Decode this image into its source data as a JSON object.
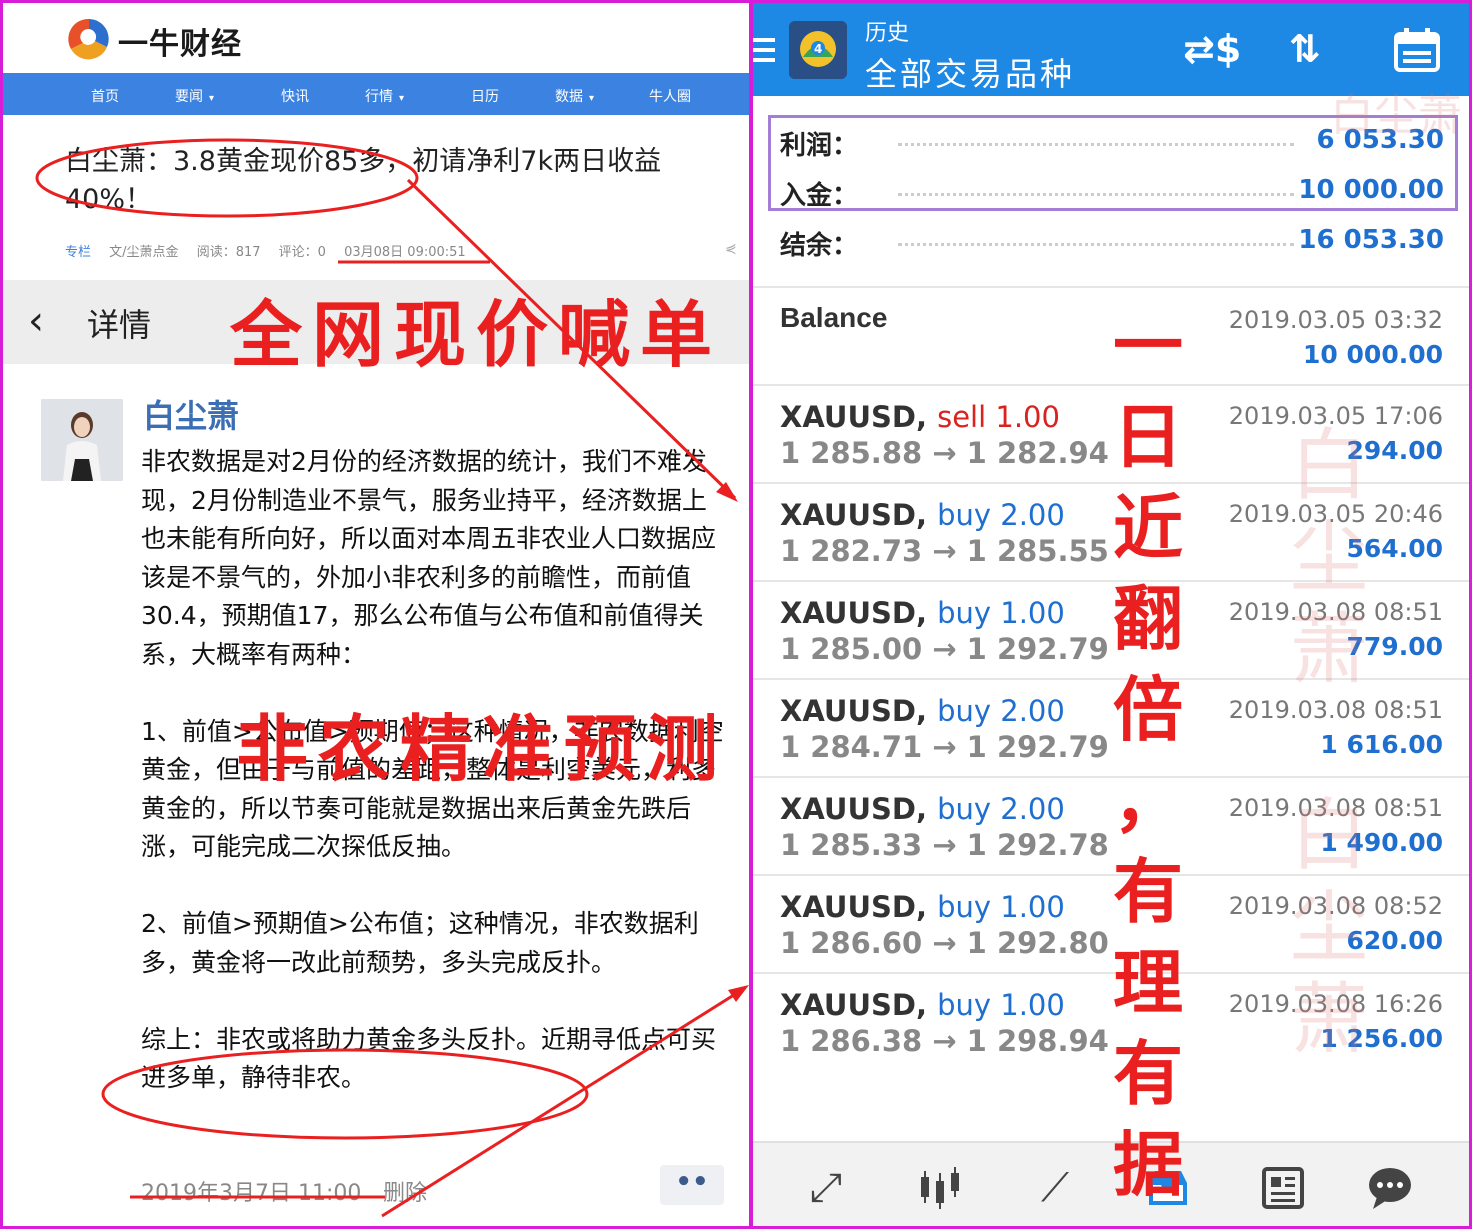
{
  "left": {
    "logo_text": "一牛财经",
    "nav": [
      {
        "label": "首页",
        "dropdown": false
      },
      {
        "label": "要闻",
        "dropdown": true
      },
      {
        "label": "快讯",
        "dropdown": false
      },
      {
        "label": "行情",
        "dropdown": true
      },
      {
        "label": "日历",
        "dropdown": false
      },
      {
        "label": "数据",
        "dropdown": true
      },
      {
        "label": "牛人圈",
        "dropdown": false
      }
    ],
    "article_title": "白尘萧：3.8黄金现价85多，初请净利7k两日收益40%！",
    "meta": {
      "column": "专栏",
      "author": "文/尘萧点金",
      "reads": "阅读：817",
      "comments": "评论：0",
      "date": "03月08日 09:00:51"
    },
    "detail_label": "详情",
    "author_name": "白尘萧",
    "paragraphs": [
      "非农数据是对2月份的经济数据的统计，我们不难发现，2月份制造业不景气，服务业持平，经济数据上也未能有所向好，所以面对本周五非农业人口数据应该是不景气的，外加小非农利多的前瞻性，而前值30.4，预期值17，那么公布值与公布值和前值得关系，大概率有两种：",
      "1、前值>公布值>预期值；这种情况，非农数据利空黄金，但由于与前值的差距，整体是利空美元，利多黄金的，所以节奏可能就是数据出来后黄金先跌后涨，可能完成二次探低反抽。",
      "2、前值>预期值>公布值；这种情况，非农数据利多，黄金将一改此前颓势，多头完成反扑。",
      "综上：非农或将助力黄金多头反扑。近期寻低点可买进多单，静待非农。"
    ],
    "post_time": "2019年3月7日 11:00",
    "delete_label": "删除",
    "more_label": "••"
  },
  "right": {
    "header_sub": "历史",
    "header_title": "全部交易品种",
    "summary": [
      {
        "label": "利润：",
        "value": "6 053.30"
      },
      {
        "label": "入金：",
        "value": "10 000.00"
      },
      {
        "label": "结余：",
        "value": "16 053.30"
      }
    ],
    "balance": {
      "title": "Balance",
      "date": "2019.03.05 03:32",
      "amount": "10 000.00"
    },
    "trades": [
      {
        "symbol": "XAUUSD,",
        "side": "sell",
        "volume": "sell 1.00",
        "prices": "1 285.88 → 1 282.94",
        "date": "2019.03.05 17:06",
        "amount": "294.00"
      },
      {
        "symbol": "XAUUSD,",
        "side": "buy",
        "volume": "buy 2.00",
        "prices": "1 282.73 → 1 285.55",
        "date": "2019.03.05 20:46",
        "amount": "564.00"
      },
      {
        "symbol": "XAUUSD,",
        "side": "buy",
        "volume": "buy 1.00",
        "prices": "1 285.00 → 1 292.79",
        "date": "2019.03.08 08:51",
        "amount": "779.00"
      },
      {
        "symbol": "XAUUSD,",
        "side": "buy",
        "volume": "buy 2.00",
        "prices": "1 284.71 → 1 292.79",
        "date": "2019.03.08 08:51",
        "amount": "1 616.00"
      },
      {
        "symbol": "XAUUSD,",
        "side": "buy",
        "volume": "buy 2.00",
        "prices": "1 285.33 → 1 292.78",
        "date": "2019.03.08 08:51",
        "amount": "1 490.00"
      },
      {
        "symbol": "XAUUSD,",
        "side": "buy",
        "volume": "buy 1.00",
        "prices": "1 286.60 → 1 292.80",
        "date": "2019.03.08 08:52",
        "amount": "620.00"
      },
      {
        "symbol": "XAUUSD,",
        "side": "buy",
        "volume": "buy 1.00",
        "prices": "1 286.38 → 1 298.94",
        "date": "2019.03.08 16:26",
        "amount": "1 256.00"
      }
    ],
    "bottom_nav_icons": [
      "trade-arrows-icon",
      "candlestick-icon",
      "chart-line-icon",
      "inbox-history-icon",
      "news-icon",
      "chat-icon"
    ]
  },
  "annotations": {
    "callout_1": "全网现价喊单",
    "callout_2": "非农精准预测",
    "vertical": "一日近翻倍，有理有据",
    "watermark": "白尘萧"
  },
  "colors": {
    "accent_blue": "#1e88e5",
    "nav_blue": "#3c82e0",
    "frame_magenta": "#d81dd8",
    "annotation_red": "#ea2020",
    "sell_red": "#d9231f",
    "summary_box": "#a37ed6"
  }
}
